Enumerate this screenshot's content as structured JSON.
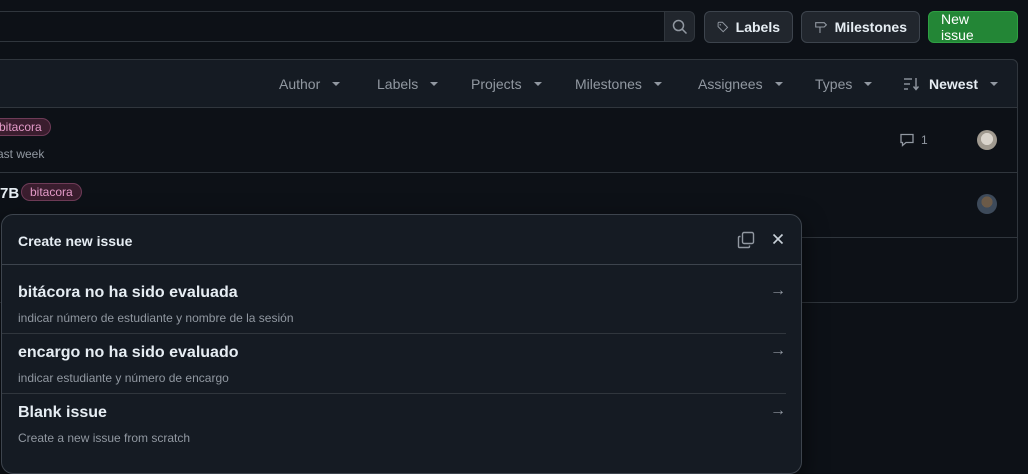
{
  "header": {
    "labels_btn": "Labels",
    "milestones_btn": "Milestones",
    "new_issue_btn": "New issue"
  },
  "filters": {
    "author": "Author",
    "labels": "Labels",
    "projects": "Projects",
    "milestones": "Milestones",
    "assignees": "Assignees",
    "types": "Types",
    "sort": "Newest"
  },
  "issues": [
    {
      "label": "bitacora",
      "meta": "ast week",
      "comments": "1"
    },
    {
      "title_fragment": "7B",
      "label": "bitacora"
    }
  ],
  "modal": {
    "title": "Create new issue",
    "templates": [
      {
        "title": "bitácora no ha sido evaluada",
        "desc": "indicar número de estudiante y nombre de la sesión"
      },
      {
        "title": "encargo no ha sido evaluado",
        "desc": "indicar estudiante y número de encargo"
      },
      {
        "title": "Blank issue",
        "desc": "Create a new issue from scratch"
      }
    ]
  },
  "colors": {
    "primary": "#238636",
    "label_bg": "#3a1d2e",
    "label_text": "#e39ac8"
  }
}
